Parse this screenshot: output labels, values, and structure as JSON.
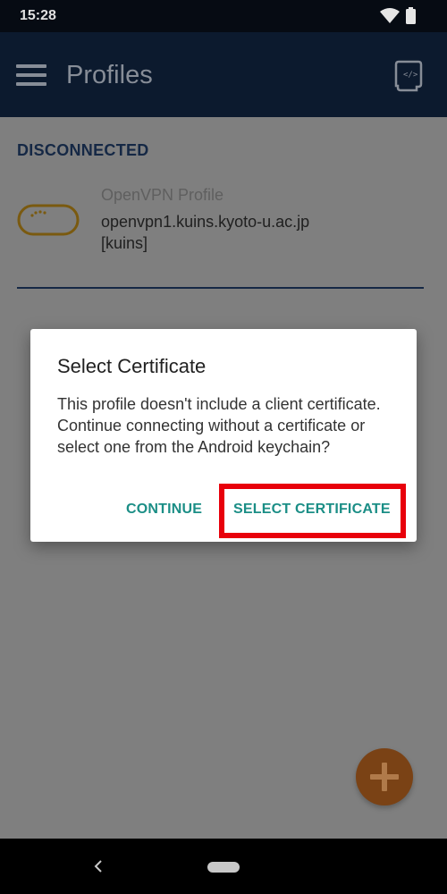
{
  "status_bar": {
    "time": "15:28"
  },
  "app_bar": {
    "title": "Profiles",
    "menu_icon": "menu-icon",
    "import_icon": "import-profile-icon"
  },
  "profiles_section": {
    "header": "DISCONNECTED",
    "items": [
      {
        "name": "OpenVPN Profile",
        "host": "openvpn1.kuins.kyoto-u.ac.jp",
        "user": "[kuins]"
      }
    ]
  },
  "dialog": {
    "title": "Select Certificate",
    "message": "This profile doesn't include a client certificate. Continue connecting without a certificate or select one from the Android keychain?",
    "buttons": {
      "continue": "CONTINUE",
      "select_certificate": "SELECT CERTIFICATE"
    }
  },
  "colors": {
    "accent": "#1b8e86",
    "app_bar": "#0c1a2e",
    "fab": "#7a4215",
    "highlight": "#e8000b"
  }
}
